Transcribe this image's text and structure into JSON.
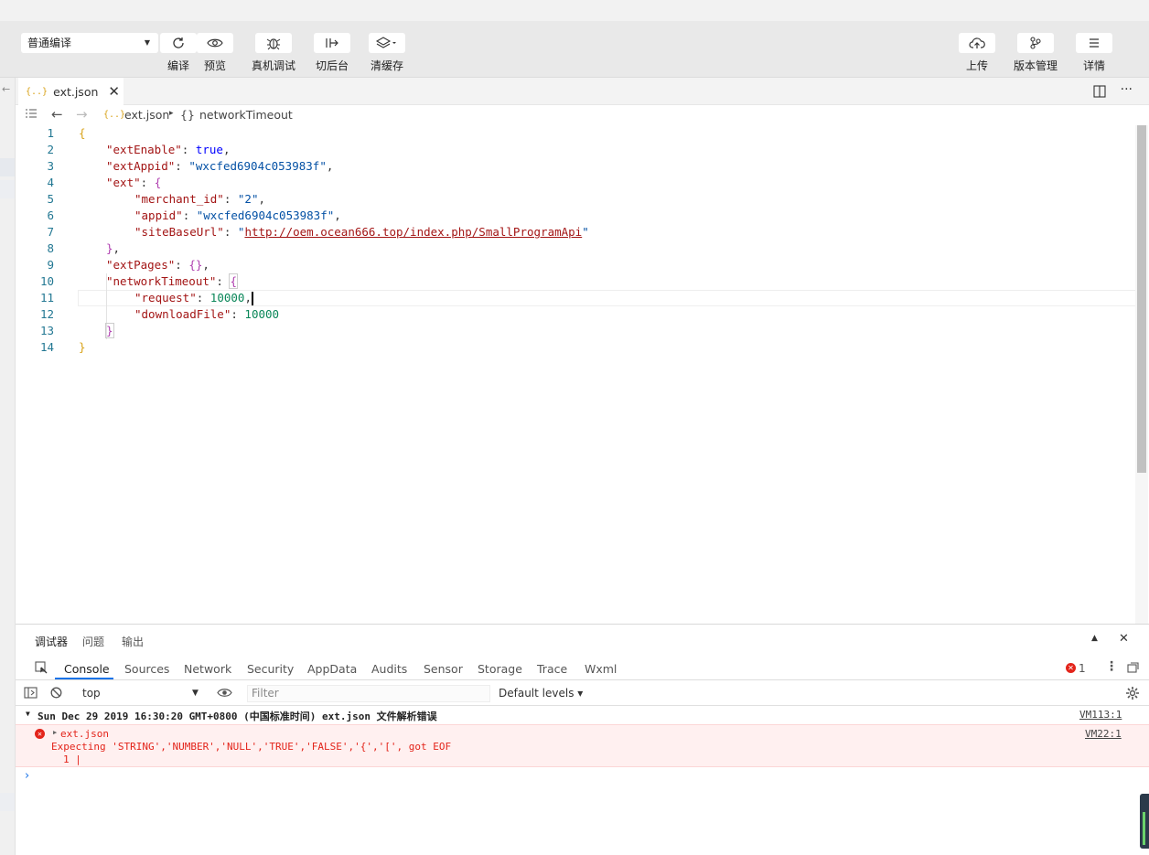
{
  "toolbar": {
    "compile_mode": "普通编译",
    "buttons": {
      "compile": "编译",
      "preview": "预览",
      "real_debug": "真机调试",
      "background": "切后台",
      "clear_cache": "清缓存",
      "upload": "上传",
      "version": "版本管理",
      "details": "详情"
    }
  },
  "editor_tab": {
    "icon": "{..}",
    "filename": "ext.json"
  },
  "breadcrumb": {
    "file_icon": "{..}",
    "file": "ext.json",
    "separator": "▸",
    "node_icon": "{}",
    "node": "networkTimeout"
  },
  "code": {
    "line_numbers": [
      "1",
      "2",
      "3",
      "4",
      "5",
      "6",
      "7",
      "8",
      "9",
      "10",
      "11",
      "12",
      "13",
      "14"
    ],
    "lines": {
      "l1_open": "{",
      "l2_key": "\"extEnable\"",
      "l2_colon": ": ",
      "l2_val": "true",
      "l2_comma": ",",
      "l3_key": "\"extAppid\"",
      "l3_colon": ": ",
      "l3_val": "\"wxcfed6904c053983f\"",
      "l3_comma": ",",
      "l4_key": "\"ext\"",
      "l4_colon": ": ",
      "l4_open": "{",
      "l5_key": "\"merchant_id\"",
      "l5_colon": ": ",
      "l5_val": "\"2\"",
      "l5_comma": ",",
      "l6_key": "\"appid\"",
      "l6_colon": ": ",
      "l6_val": "\"wxcfed6904c053983f\"",
      "l6_comma": ",",
      "l7_key": "\"siteBaseUrl\"",
      "l7_colon": ": ",
      "l7_q1": "\"",
      "l7_url": "http://oem.ocean666.top/index.php/SmallProgramApi",
      "l7_q2": "\"",
      "l8_close": "}",
      "l8_comma": ",",
      "l9_key": "\"extPages\"",
      "l9_colon": ": ",
      "l9_val": "{}",
      "l9_comma": ",",
      "l10_key": "\"networkTimeout\"",
      "l10_colon": ": ",
      "l10_open": "{",
      "l11_key": "\"request\"",
      "l11_colon": ": ",
      "l11_val": "10000",
      "l11_comma": ",",
      "l12_key": "\"downloadFile\"",
      "l12_colon": ": ",
      "l12_val": "10000",
      "l13_close": "}",
      "l14_close": "}"
    }
  },
  "panel": {
    "tabs": [
      "调试器",
      "问题",
      "输出"
    ],
    "devtools_tabs": [
      "Console",
      "Sources",
      "Network",
      "Security",
      "AppData",
      "Audits",
      "Sensor",
      "Storage",
      "Trace",
      "Wxml"
    ],
    "error_count": "1",
    "context": "top",
    "filter_placeholder": "Filter",
    "levels": "Default levels ▾",
    "group_header": "Sun Dec 29 2019 16:30:20 GMT+0800 (中国标准时间)  ext.json 文件解析错误",
    "group_source": "VM113:1",
    "error_file": "ext.json",
    "error_source": "VM22:1",
    "error_message": "Expecting 'STRING','NUMBER','NULL','TRUE','FALSE','{','[', got EOF",
    "error_line": "1 |",
    "prompt": "›"
  },
  "colors": {
    "accent": "#1a73e8",
    "error_red": "#e3241a",
    "json_key": "#a31515",
    "json_string": "#0451a5",
    "json_value": "#0000ff"
  }
}
